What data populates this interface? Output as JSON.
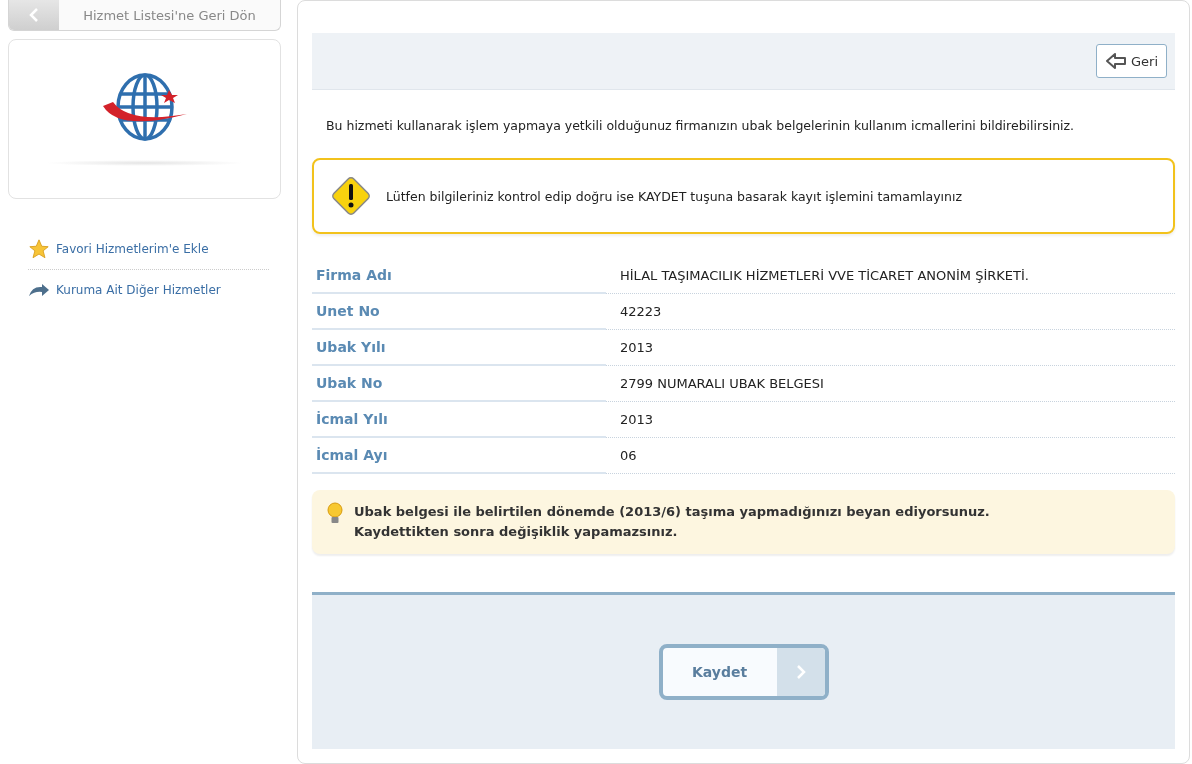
{
  "back_to_list": {
    "label": "Hizmet Listesi'ne Geri Dön"
  },
  "sidebar": {
    "links": [
      {
        "kind": "star",
        "label": "Favori Hizmetlerim'e Ekle"
      },
      {
        "kind": "arrow",
        "label": "Kuruma Ait Diğer Hizmetler"
      }
    ]
  },
  "toolbar": {
    "back_button": "Geri"
  },
  "intro": "Bu hizmeti kullanarak işlem yapmaya yetkili olduğunuz firmanızın ubak belgelerinin kullanım icmallerini bildirebilirsiniz.",
  "warning": "Lütfen bilgileriniz kontrol edip doğru ise KAYDET tuşuna basarak kayıt işlemini tamamlayınız",
  "fields": [
    {
      "label": "Firma Adı",
      "value": "HİLAL TAŞIMACILIK HİZMETLERİ VVE TİCARET ANONİM ŞİRKETİ."
    },
    {
      "label": "Unet No",
      "value": "42223"
    },
    {
      "label": "Ubak Yılı",
      "value": "2013"
    },
    {
      "label": "Ubak No",
      "value": "2799 NUMARALI UBAK BELGESI"
    },
    {
      "label": "İcmal Yılı",
      "value": "2013"
    },
    {
      "label": "İcmal Ayı",
      "value": "06"
    }
  ],
  "notice": [
    "Ubak belgesi ile belirtilen dönemde (2013/6) taşıma yapmadığınızı beyan ediyorsunuz.",
    "Kaydettikten sonra değişiklik yapamazsınız."
  ],
  "save_button": "Kaydet"
}
